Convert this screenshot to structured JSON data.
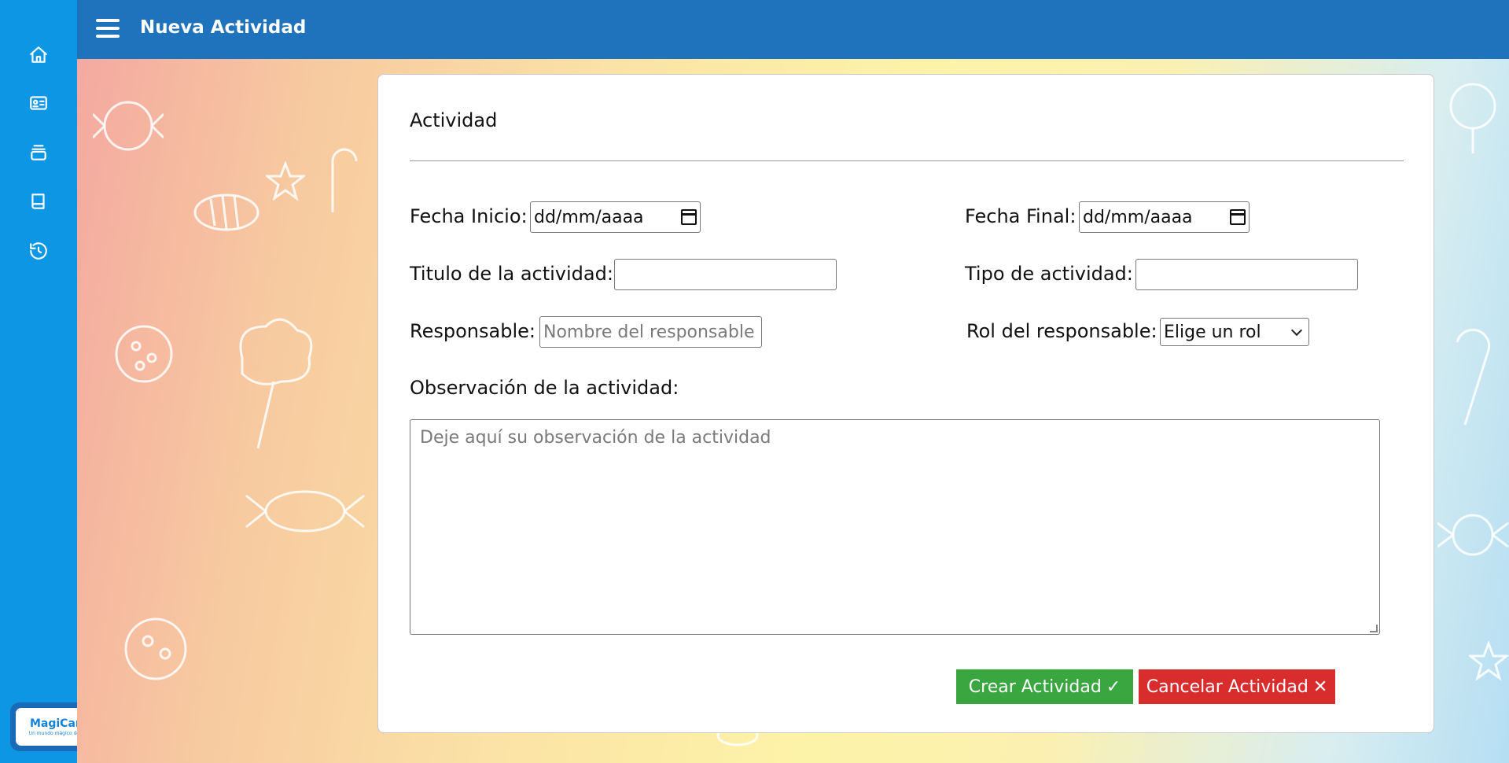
{
  "header": {
    "title": "Nueva Actividad"
  },
  "sidebar": {
    "icons": [
      "home-icon",
      "id-card-icon",
      "stack-icon",
      "book-icon",
      "history-icon"
    ]
  },
  "logo": {
    "title": "MagiCandy",
    "subtitle": "Un mundo mágico de sabores"
  },
  "form": {
    "section_title": "Actividad",
    "fecha_inicio": {
      "label": "Fecha Inicio:",
      "value": "dd/mm/aaaa"
    },
    "fecha_final": {
      "label": "Fecha Final:",
      "value": "dd/mm/aaaa"
    },
    "titulo": {
      "label": "Titulo de la actividad:",
      "value": ""
    },
    "tipo": {
      "label": "Tipo de actividad:",
      "value": ""
    },
    "responsable": {
      "label": "Responsable:",
      "placeholder": "Nombre del responsable"
    },
    "rol": {
      "label": "Rol del responsable:",
      "selected": "Elige un rol"
    },
    "observacion": {
      "label": "Observación de la actividad:",
      "placeholder": "Deje aquí su observación de la actividad"
    }
  },
  "buttons": {
    "create_label": "Crear Actividad",
    "create_glyph": "✓",
    "cancel_label": "Cancelar Actividad",
    "cancel_glyph": "✕"
  },
  "colors": {
    "sidebar": "#0d96e3",
    "header": "#1f72bc",
    "create": "#3aa640",
    "cancel": "#d92d2d"
  }
}
